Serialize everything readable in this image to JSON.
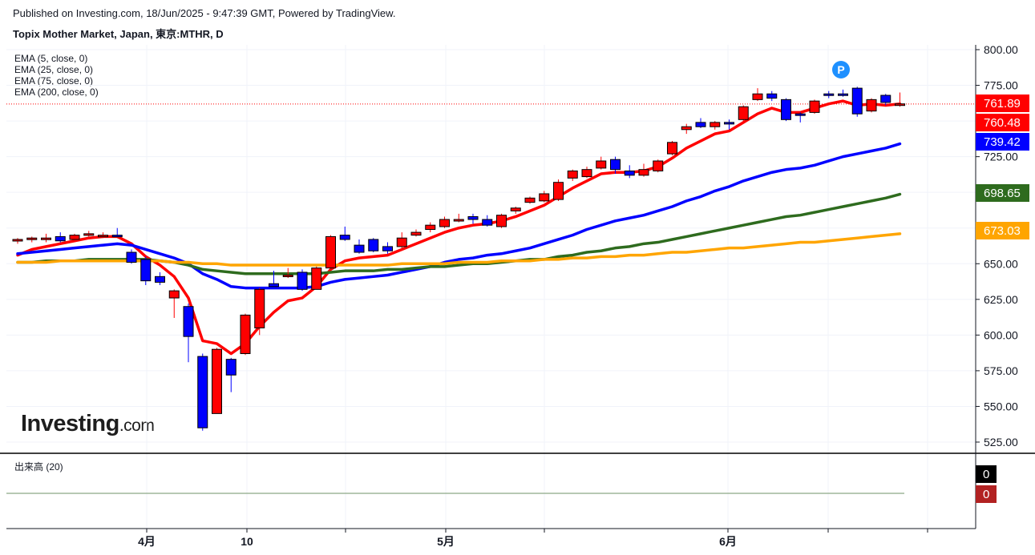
{
  "header": {
    "published": "Published on Investing.com, 18/Jun/2025 - 9:47:39 GMT, Powered by TradingView.",
    "title": "Topix Mother Market, Japan, 東京:MTHR, D"
  },
  "legend": [
    "EMA (5, close, 0)",
    "EMA (25, close, 0)",
    "EMA (75, close, 0)",
    "EMA (200, close, 0)"
  ],
  "volume_legend": "出来高 (20)",
  "logo": {
    "main": "Investing",
    "suffix": ".com"
  },
  "marker": "P",
  "price_tags": [
    {
      "text": "761.89",
      "value": 761.89,
      "color": "#ff0000"
    },
    {
      "text": "760.48",
      "value": 760.48,
      "color": "#ff0000"
    },
    {
      "text": "739.42",
      "value": 739.42,
      "color": "#0000ff"
    },
    {
      "text": "698.65",
      "value": 698.65,
      "color": "#2e6b1e"
    },
    {
      "text": "673.03",
      "value": 673.03,
      "color": "#ffa500"
    }
  ],
  "volume_tags": [
    {
      "text": "0",
      "color": "#000000"
    },
    {
      "text": "0",
      "color": "#b22222"
    }
  ],
  "chart_data": {
    "type": "candlestick",
    "y_ticks": [
      "800.00",
      "775.00",
      "750.00",
      "725.00",
      "700.00",
      "675.00",
      "650.00",
      "625.00",
      "600.00",
      "575.00",
      "550.00",
      "525.00"
    ],
    "y_range": [
      515,
      805
    ],
    "x_labels": [
      "4月",
      "10",
      "5月",
      "6月"
    ],
    "colors": {
      "up": "#ff0000",
      "down": "#0000ff"
    },
    "candles": [
      {
        "o": 666,
        "h": 668,
        "l": 664,
        "c": 667
      },
      {
        "o": 667,
        "h": 669,
        "l": 665,
        "c": 668
      },
      {
        "o": 667,
        "h": 671,
        "l": 665,
        "c": 668
      },
      {
        "o": 669,
        "h": 672,
        "l": 665,
        "c": 666
      },
      {
        "o": 667,
        "h": 671,
        "l": 666,
        "c": 670
      },
      {
        "o": 670,
        "h": 673,
        "l": 669,
        "c": 671
      },
      {
        "o": 670,
        "h": 672,
        "l": 668,
        "c": 670
      },
      {
        "o": 670,
        "h": 675,
        "l": 669,
        "c": 669
      },
      {
        "o": 658,
        "h": 660,
        "l": 650,
        "c": 651
      },
      {
        "o": 653,
        "h": 655,
        "l": 635,
        "c": 638
      },
      {
        "o": 641,
        "h": 644,
        "l": 635,
        "c": 637
      },
      {
        "o": 626,
        "h": 632,
        "l": 612,
        "c": 631
      },
      {
        "o": 620,
        "h": 622,
        "l": 581,
        "c": 599
      },
      {
        "o": 585,
        "h": 587,
        "l": 533,
        "c": 535
      },
      {
        "o": 545,
        "h": 591,
        "l": 545,
        "c": 590
      },
      {
        "o": 583,
        "h": 584,
        "l": 560,
        "c": 572
      },
      {
        "o": 587,
        "h": 615,
        "l": 586,
        "c": 614
      },
      {
        "o": 605,
        "h": 633,
        "l": 600,
        "c": 632
      },
      {
        "o": 636,
        "h": 645,
        "l": 633,
        "c": 634
      },
      {
        "o": 641,
        "h": 647,
        "l": 640,
        "c": 642
      },
      {
        "o": 644,
        "h": 646,
        "l": 631,
        "c": 632
      },
      {
        "o": 632,
        "h": 648,
        "l": 632,
        "c": 647
      },
      {
        "o": 647,
        "h": 670,
        "l": 647,
        "c": 669
      },
      {
        "o": 670,
        "h": 676,
        "l": 666,
        "c": 667
      },
      {
        "o": 663,
        "h": 667,
        "l": 657,
        "c": 658
      },
      {
        "o": 667,
        "h": 668,
        "l": 658,
        "c": 659
      },
      {
        "o": 662,
        "h": 665,
        "l": 657,
        "c": 659
      },
      {
        "o": 662,
        "h": 672,
        "l": 660,
        "c": 668
      },
      {
        "o": 670,
        "h": 674,
        "l": 669,
        "c": 672
      },
      {
        "o": 674,
        "h": 679,
        "l": 672,
        "c": 677
      },
      {
        "o": 676,
        "h": 683,
        "l": 675,
        "c": 681
      },
      {
        "o": 681,
        "h": 685,
        "l": 679,
        "c": 681
      },
      {
        "o": 683,
        "h": 685,
        "l": 678,
        "c": 681
      },
      {
        "o": 681,
        "h": 684,
        "l": 676,
        "c": 677
      },
      {
        "o": 676,
        "h": 685,
        "l": 675,
        "c": 684
      },
      {
        "o": 687,
        "h": 690,
        "l": 685,
        "c": 689
      },
      {
        "o": 693,
        "h": 697,
        "l": 692,
        "c": 696
      },
      {
        "o": 694,
        "h": 701,
        "l": 693,
        "c": 699
      },
      {
        "o": 695,
        "h": 709,
        "l": 694,
        "c": 707
      },
      {
        "o": 710,
        "h": 716,
        "l": 708,
        "c": 715
      },
      {
        "o": 711,
        "h": 718,
        "l": 710,
        "c": 716
      },
      {
        "o": 717,
        "h": 725,
        "l": 716,
        "c": 722
      },
      {
        "o": 723,
        "h": 725,
        "l": 713,
        "c": 716
      },
      {
        "o": 715,
        "h": 719,
        "l": 710,
        "c": 712
      },
      {
        "o": 712,
        "h": 720,
        "l": 711,
        "c": 716
      },
      {
        "o": 715,
        "h": 723,
        "l": 714,
        "c": 722
      },
      {
        "o": 727,
        "h": 736,
        "l": 726,
        "c": 735
      },
      {
        "o": 744,
        "h": 748,
        "l": 741,
        "c": 746
      },
      {
        "o": 749,
        "h": 752,
        "l": 745,
        "c": 746
      },
      {
        "o": 746,
        "h": 750,
        "l": 744,
        "c": 749
      },
      {
        "o": 749,
        "h": 751,
        "l": 744,
        "c": 748
      },
      {
        "o": 751,
        "h": 761,
        "l": 750,
        "c": 760
      },
      {
        "o": 765,
        "h": 773,
        "l": 764,
        "c": 769
      },
      {
        "o": 769,
        "h": 771,
        "l": 764,
        "c": 766
      },
      {
        "o": 765,
        "h": 766,
        "l": 750,
        "c": 751
      },
      {
        "o": 755,
        "h": 756,
        "l": 749,
        "c": 754
      },
      {
        "o": 756,
        "h": 765,
        "l": 755,
        "c": 764
      },
      {
        "o": 769,
        "h": 771,
        "l": 766,
        "c": 768
      },
      {
        "o": 769,
        "h": 772,
        "l": 767,
        "c": 768
      },
      {
        "o": 773,
        "h": 774,
        "l": 753,
        "c": 755
      },
      {
        "o": 757,
        "h": 766,
        "l": 756,
        "c": 765
      },
      {
        "o": 768,
        "h": 769,
        "l": 761,
        "c": 763
      },
      {
        "o": 761,
        "h": 770,
        "l": 760,
        "c": 762
      }
    ],
    "series": [
      {
        "name": "EMA (5, close, 0)",
        "color": "#ff0000",
        "values": [
          656,
          660,
          662,
          664,
          666,
          668,
          669,
          669,
          664,
          655,
          649,
          641,
          626,
          596,
          594,
          587,
          594,
          606,
          616,
          624,
          626,
          634,
          646,
          652,
          654,
          655,
          656,
          660,
          664,
          668,
          672,
          675,
          677,
          678,
          680,
          683,
          687,
          691,
          697,
          703,
          708,
          713,
          714,
          714,
          715,
          718,
          724,
          731,
          736,
          741,
          743,
          749,
          755,
          759,
          756,
          756,
          759,
          762,
          764,
          761,
          762,
          761,
          762
        ]
      },
      {
        "name": "EMA (25, close, 0)",
        "color": "#0000ff",
        "values": [
          657,
          658,
          659,
          660,
          661,
          662,
          663,
          664,
          663,
          660,
          657,
          654,
          650,
          643,
          639,
          634,
          633,
          633,
          633,
          633,
          633,
          634,
          637,
          639,
          640,
          641,
          642,
          644,
          646,
          648,
          651,
          653,
          654,
          656,
          657,
          659,
          661,
          664,
          667,
          670,
          674,
          677,
          680,
          682,
          684,
          687,
          690,
          694,
          697,
          701,
          704,
          708,
          711,
          714,
          716,
          717,
          719,
          722,
          725,
          727,
          729,
          731,
          734
        ]
      },
      {
        "name": "EMA (75, close, 0)",
        "color": "#2e6b1e",
        "values": [
          651,
          651,
          652,
          652,
          652,
          653,
          653,
          653,
          653,
          653,
          652,
          651,
          649,
          646,
          645,
          644,
          643,
          643,
          643,
          643,
          643,
          643,
          644,
          645,
          645,
          645,
          646,
          646,
          647,
          648,
          648,
          649,
          650,
          650,
          651,
          652,
          653,
          653,
          655,
          656,
          658,
          659,
          661,
          662,
          664,
          665,
          667,
          669,
          671,
          673,
          675,
          677,
          679,
          681,
          683,
          684,
          686,
          688,
          690,
          692,
          694,
          696,
          698.65
        ]
      },
      {
        "name": "EMA (200, close, 0)",
        "color": "#ffa500",
        "values": [
          651,
          651,
          651,
          652,
          652,
          652,
          652,
          652,
          652,
          652,
          652,
          651,
          651,
          650,
          650,
          649,
          649,
          649,
          649,
          649,
          649,
          649,
          649,
          649,
          649,
          649,
          649,
          650,
          650,
          650,
          650,
          651,
          651,
          651,
          652,
          652,
          652,
          653,
          653,
          654,
          654,
          655,
          655,
          656,
          656,
          657,
          658,
          658,
          659,
          660,
          661,
          661,
          662,
          663,
          664,
          665,
          665,
          666,
          667,
          668,
          669,
          670,
          671
        ]
      }
    ],
    "volume_level": 0
  }
}
